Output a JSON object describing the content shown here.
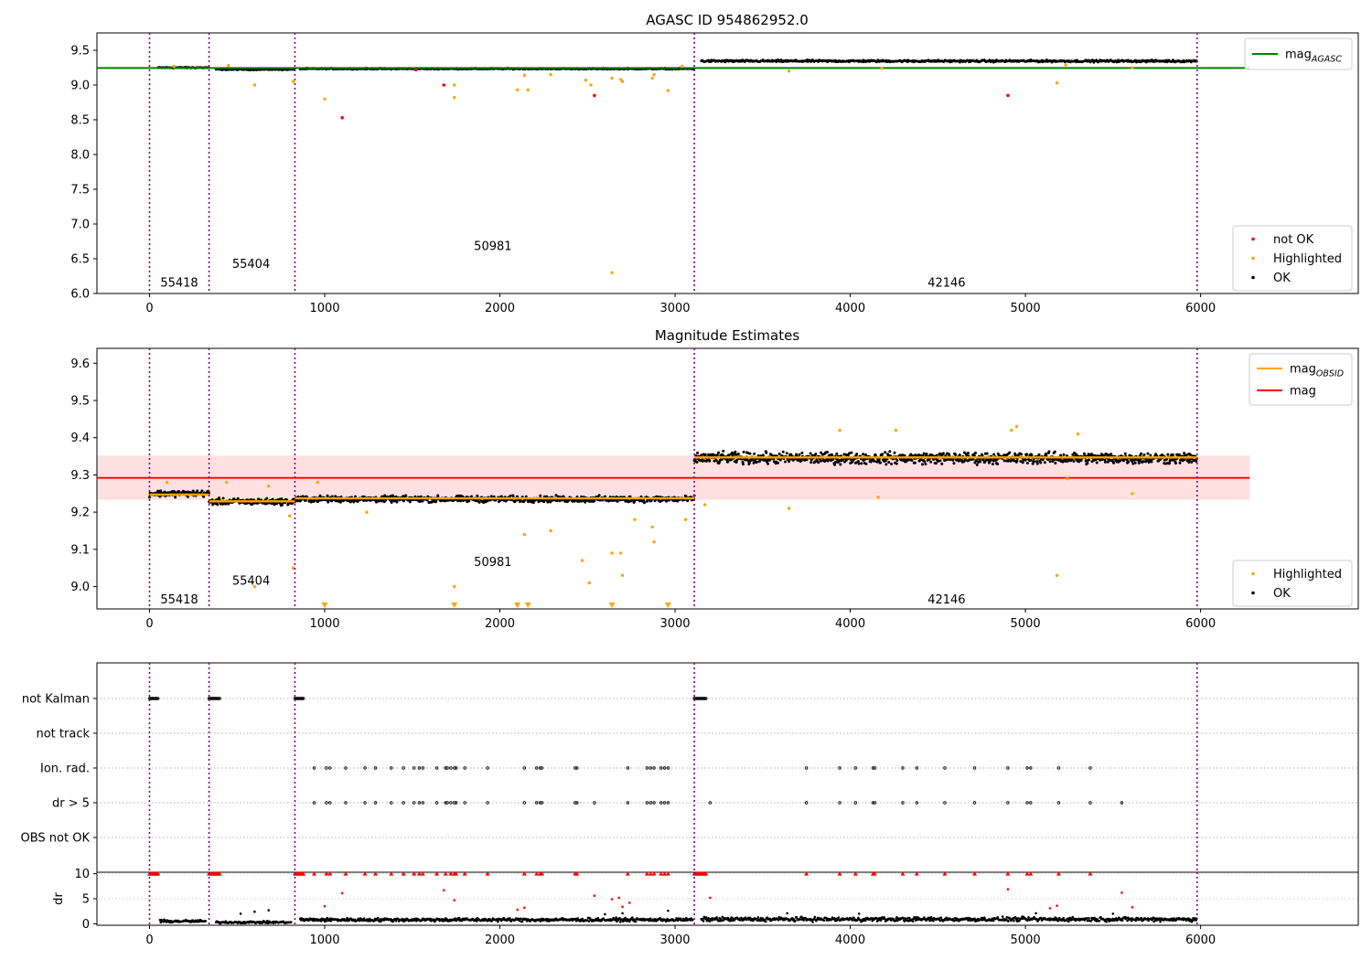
{
  "chart_data": [
    {
      "type": "scatter",
      "title": "AGASC ID 954862952.0",
      "xlim": [
        -300,
        6900
      ],
      "ylim": [
        6.0,
        9.75
      ],
      "xticks": [
        0,
        1000,
        2000,
        3000,
        4000,
        5000,
        6000
      ],
      "xtick_labels": [
        "0",
        "1000",
        "2000",
        "3000",
        "4000",
        "5000",
        "6000"
      ],
      "yticks": [
        6.0,
        6.5,
        7.0,
        7.5,
        8.0,
        8.5,
        9.0,
        9.5
      ],
      "ytick_labels": [
        "6.0",
        "6.5",
        "7.0",
        "7.5",
        "8.0",
        "8.5",
        "9.0",
        "9.5"
      ],
      "obs_boundaries": [
        0,
        340,
        830,
        3110,
        5980
      ],
      "obs_labels": [
        {
          "text": "55418",
          "x": 170,
          "y": 6.15
        },
        {
          "text": "55404",
          "x": 580,
          "y": 6.42
        },
        {
          "text": "50981",
          "x": 1960,
          "y": 6.68
        },
        {
          "text": "42146",
          "x": 4550,
          "y": 6.15
        }
      ],
      "reference_lines": [
        {
          "name": "mag_AGASC",
          "value": 9.245,
          "x_range": [
            -300,
            6280
          ],
          "color": "#008000"
        }
      ],
      "legend_top": [
        {
          "name": "mag",
          "subscript": "AGASC",
          "color": "#008000",
          "kind": "line"
        }
      ],
      "legend_bottom": [
        {
          "name": "not OK",
          "color": "#ff0000",
          "kind": "point"
        },
        {
          "name": "Highlighted",
          "color": "#ffa500",
          "kind": "point"
        },
        {
          "name": "OK",
          "color": "#000000",
          "kind": "point"
        }
      ],
      "legend_placement": [
        "upper right",
        "lower right"
      ],
      "ok_segments": [
        {
          "x0": 50,
          "x1": 340,
          "y": 9.25,
          "noise": 0.012
        },
        {
          "x0": 380,
          "x1": 830,
          "y": 9.225,
          "noise": 0.012
        },
        {
          "x0": 860,
          "x1": 3110,
          "y": 9.235,
          "noise": 0.012
        },
        {
          "x0": 3150,
          "x1": 5980,
          "y": 9.345,
          "noise": 0.022
        }
      ],
      "not_ok_points": [
        [
          1100,
          8.53
        ],
        [
          1520,
          9.22
        ],
        [
          1680,
          9.0
        ],
        [
          2540,
          8.85
        ],
        [
          4900,
          8.85
        ]
      ],
      "highlighted_points": [
        [
          140,
          9.27
        ],
        [
          450,
          9.28
        ],
        [
          600,
          9.0
        ],
        [
          820,
          9.05
        ],
        [
          1000,
          8.8
        ],
        [
          1740,
          9.0
        ],
        [
          1740,
          8.82
        ],
        [
          2100,
          8.93
        ],
        [
          2140,
          9.14
        ],
        [
          2160,
          8.93
        ],
        [
          2290,
          9.15
        ],
        [
          2490,
          9.07
        ],
        [
          2520,
          9.0
        ],
        [
          2640,
          9.1
        ],
        [
          2690,
          9.08
        ],
        [
          2700,
          9.05
        ],
        [
          2870,
          9.1
        ],
        [
          2880,
          9.15
        ],
        [
          2960,
          8.92
        ],
        [
          3040,
          9.27
        ],
        [
          3650,
          9.2
        ],
        [
          4180,
          9.24
        ],
        [
          5180,
          9.03
        ],
        [
          5230,
          9.29
        ],
        [
          5610,
          9.25
        ],
        [
          2640,
          6.3
        ]
      ]
    },
    {
      "type": "scatter",
      "title": "Magnitude Estimates",
      "xlim": [
        -300,
        6900
      ],
      "ylim": [
        8.94,
        9.64
      ],
      "xticks": [
        0,
        1000,
        2000,
        3000,
        4000,
        5000,
        6000
      ],
      "xtick_labels": [
        "0",
        "1000",
        "2000",
        "3000",
        "4000",
        "5000",
        "6000"
      ],
      "yticks": [
        9.0,
        9.1,
        9.2,
        9.3,
        9.4,
        9.5,
        9.6
      ],
      "ytick_labels": [
        "9.0",
        "9.1",
        "9.2",
        "9.3",
        "9.4",
        "9.5",
        "9.6"
      ],
      "obs_boundaries": [
        0,
        340,
        830,
        3110,
        5980
      ],
      "obs_labels": [
        {
          "text": "55418",
          "x": 170,
          "y": 8.965
        },
        {
          "text": "55404",
          "x": 580,
          "y": 9.015
        },
        {
          "text": "50981",
          "x": 1960,
          "y": 9.065
        },
        {
          "text": "42146",
          "x": 4550,
          "y": 8.965
        }
      ],
      "mag": 9.292,
      "mag_band": [
        9.233,
        9.352
      ],
      "mag_x_range": [
        -300,
        6280
      ],
      "mag_obsid_segments": [
        {
          "x0": 0,
          "x1": 340,
          "y": 9.247
        },
        {
          "x0": 340,
          "x1": 830,
          "y": 9.229
        },
        {
          "x0": 830,
          "x1": 3110,
          "y": 9.237
        },
        {
          "x0": 3110,
          "x1": 5980,
          "y": 9.347
        }
      ],
      "legend_top": [
        {
          "name": "mag",
          "subscript": "OBSID",
          "color": "#ffa500",
          "kind": "line"
        },
        {
          "name": "mag",
          "subscript": "",
          "color": "#ff0000",
          "kind": "line"
        }
      ],
      "legend_bottom": [
        {
          "name": "Highlighted",
          "color": "#ffa500",
          "kind": "point"
        },
        {
          "name": "OK",
          "color": "#000000",
          "kind": "point"
        }
      ],
      "legend_placement": [
        "upper right",
        "lower right"
      ],
      "ok_segments": [
        {
          "x0": 0,
          "x1": 340,
          "y": 9.25,
          "noise": 0.012
        },
        {
          "x0": 340,
          "x1": 830,
          "y": 9.228,
          "noise": 0.012
        },
        {
          "x0": 830,
          "x1": 3110,
          "y": 9.235,
          "noise": 0.012
        },
        {
          "x0": 3110,
          "x1": 5980,
          "y": 9.345,
          "noise": 0.022
        }
      ],
      "highlighted_points": [
        [
          100,
          9.28
        ],
        [
          440,
          9.28
        ],
        [
          600,
          9.0
        ],
        [
          680,
          9.27
        ],
        [
          800,
          9.19
        ],
        [
          820,
          9.05
        ],
        [
          960,
          9.28
        ],
        [
          1240,
          9.2
        ],
        [
          1740,
          9.0
        ],
        [
          2140,
          9.14
        ],
        [
          2290,
          9.15
        ],
        [
          2470,
          9.07
        ],
        [
          2510,
          9.01
        ],
        [
          2640,
          9.09
        ],
        [
          2690,
          9.09
        ],
        [
          2700,
          9.03
        ],
        [
          2770,
          9.18
        ],
        [
          2870,
          9.16
        ],
        [
          2880,
          9.12
        ],
        [
          3060,
          9.18
        ],
        [
          3170,
          9.22
        ],
        [
          3650,
          9.21
        ],
        [
          4160,
          9.24
        ],
        [
          5180,
          9.03
        ],
        [
          5240,
          9.29
        ],
        [
          5610,
          9.25
        ],
        [
          3940,
          9.42
        ],
        [
          4260,
          9.42
        ],
        [
          4920,
          9.42
        ],
        [
          4950,
          9.43
        ],
        [
          5300,
          9.41
        ]
      ],
      "below_range_markers": [
        1000,
        1740,
        2100,
        2160,
        2640,
        2960
      ]
    },
    {
      "type": "scatter",
      "title": "",
      "xlim": [
        -300,
        6900
      ],
      "flag_rows": [
        "not Kalman",
        "not track",
        "Ion. rad.",
        "dr > 5",
        "OBS not OK"
      ],
      "obs_boundaries": [
        0,
        340,
        830,
        3110,
        5980
      ],
      "flag_ranges": {
        "not Kalman": [
          [
            0,
            50
          ],
          [
            340,
            400
          ],
          [
            830,
            880
          ],
          [
            3110,
            3180
          ]
        ]
      },
      "flag_points": {
        "Ion. rad.": [
          940,
          1010,
          1030,
          1120,
          1230,
          1290,
          1380,
          1450,
          1510,
          1540,
          1560,
          1640,
          1690,
          1700,
          1720,
          1740,
          1750,
          1800,
          1930,
          2140,
          2210,
          2230,
          2240,
          2430,
          2440,
          2730,
          2840,
          2860,
          2880,
          2920,
          2940,
          2960,
          3750,
          3940,
          4030,
          4130,
          4140,
          4300,
          4380,
          4540,
          4710,
          4900,
          5010,
          5030,
          5190,
          5370
        ],
        "dr > 5": [
          940,
          1010,
          1030,
          1120,
          1230,
          1290,
          1380,
          1450,
          1510,
          1540,
          1560,
          1640,
          1690,
          1700,
          1720,
          1740,
          1750,
          1800,
          1930,
          2140,
          2210,
          2230,
          2240,
          2430,
          2440,
          2540,
          2730,
          2840,
          2860,
          2880,
          2920,
          2940,
          2960,
          3200,
          3750,
          3940,
          4030,
          4130,
          4140,
          4300,
          4380,
          4540,
          4710,
          4900,
          5010,
          5030,
          5190,
          5370,
          5550
        ]
      }
    },
    {
      "type": "scatter",
      "title": "",
      "xlim": [
        -300,
        6900
      ],
      "ylim": [
        -0.3,
        10.3
      ],
      "ylabel": "dr",
      "xticks": [
        0,
        1000,
        2000,
        3000,
        4000,
        5000,
        6000
      ],
      "xtick_labels": [
        "0",
        "1000",
        "2000",
        "3000",
        "4000",
        "5000",
        "6000"
      ],
      "yticks": [
        0,
        5,
        10
      ],
      "ytick_labels": [
        "0",
        "5",
        "10"
      ],
      "obs_boundaries": [
        0,
        340,
        830,
        3110,
        5980
      ],
      "clipped_at_10": [
        [
          0,
          50
        ],
        [
          340,
          400
        ],
        [
          830,
          880
        ],
        [
          3110,
          3180
        ]
      ],
      "clipped_points_x": [
        940,
        1010,
        1030,
        1120,
        1230,
        1290,
        1380,
        1450,
        1510,
        1540,
        1560,
        1640,
        1690,
        1720,
        1740,
        1750,
        1800,
        1930,
        2140,
        2210,
        2230,
        2240,
        2430,
        2440,
        2730,
        2840,
        2860,
        2880,
        2920,
        2940,
        2960,
        3750,
        3940,
        4030,
        4130,
        4140,
        4300,
        4380,
        4540,
        4710,
        4900,
        5010,
        5030,
        5190,
        5370
      ],
      "red_points": [
        [
          1000,
          3.5
        ],
        [
          1100,
          6.1
        ],
        [
          1680,
          6.7
        ],
        [
          1740,
          4.7
        ],
        [
          2100,
          2.8
        ],
        [
          2140,
          3.2
        ],
        [
          2540,
          5.6
        ],
        [
          2640,
          4.9
        ],
        [
          2680,
          5.2
        ],
        [
          2700,
          3.4
        ],
        [
          2740,
          4.2
        ],
        [
          3200,
          5.2
        ],
        [
          4900,
          6.9
        ],
        [
          5140,
          3.1
        ],
        [
          5180,
          3.6
        ],
        [
          5550,
          6.2
        ],
        [
          5610,
          3.3
        ]
      ],
      "ok_segments": [
        {
          "x0": 60,
          "x1": 320,
          "y": 0.5,
          "noise": 0.4
        },
        {
          "x0": 380,
          "x1": 810,
          "y": 0.3,
          "noise": 0.3
        },
        {
          "x0": 860,
          "x1": 3100,
          "y": 0.8,
          "noise": 0.5
        },
        {
          "x0": 3150,
          "x1": 5980,
          "y": 0.9,
          "noise": 0.6
        }
      ],
      "extra_ok_points": [
        [
          520,
          2.0
        ],
        [
          600,
          2.4
        ],
        [
          680,
          2.7
        ],
        [
          2600,
          1.9
        ],
        [
          2700,
          2.1
        ],
        [
          2960,
          2.6
        ],
        [
          3640,
          2.1
        ],
        [
          4050,
          2.0
        ],
        [
          5060,
          2.1
        ],
        [
          5500,
          2.0
        ]
      ]
    }
  ]
}
